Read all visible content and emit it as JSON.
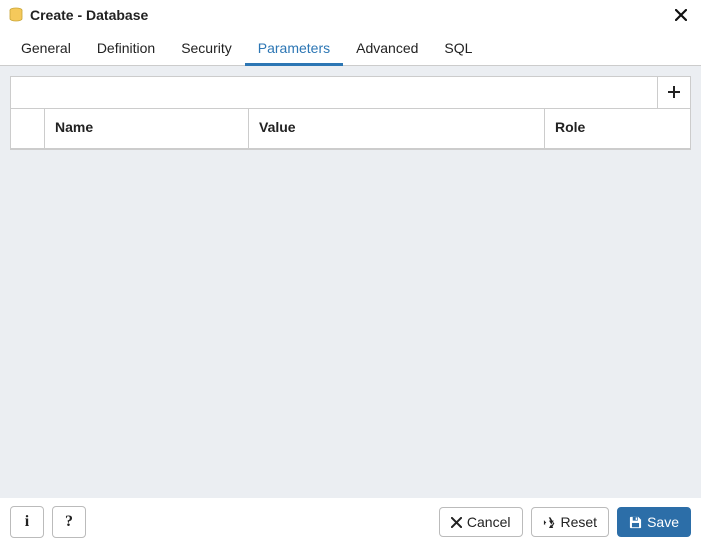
{
  "dialog": {
    "title": "Create - Database"
  },
  "tabs": [
    {
      "id": "general",
      "label": "General",
      "active": false
    },
    {
      "id": "definition",
      "label": "Definition",
      "active": false
    },
    {
      "id": "security",
      "label": "Security",
      "active": false
    },
    {
      "id": "parameters",
      "label": "Parameters",
      "active": true
    },
    {
      "id": "advanced",
      "label": "Advanced",
      "active": false
    },
    {
      "id": "sql",
      "label": "SQL",
      "active": false
    }
  ],
  "grid": {
    "columns": {
      "name": "Name",
      "value": "Value",
      "role": "Role"
    },
    "rows": []
  },
  "footer": {
    "cancel": "Cancel",
    "reset": "Reset",
    "save": "Save"
  }
}
